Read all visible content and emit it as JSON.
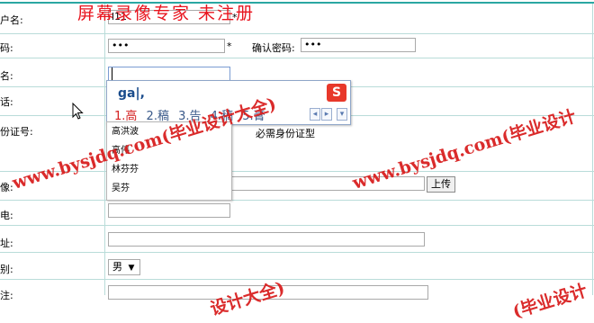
{
  "watermark": {
    "title": "屏幕录像专家 未注册",
    "site_a": "www.bysjdq.com(毕业设计大全)",
    "site_b": "www.bysjdq.com(毕业设计",
    "bottom_a": "设计大全)",
    "bottom_b": "(毕业设计"
  },
  "form": {
    "username": {
      "label": "户名:",
      "value": "l11",
      "star": "*"
    },
    "password": {
      "label": "码:",
      "value": "•••",
      "star": "*"
    },
    "confirm": {
      "label": "确认密码:",
      "value": "•••"
    },
    "name": {
      "label": "名:",
      "value": ""
    },
    "row4": {
      "label": "话:"
    },
    "idcard": {
      "label": "份证号:",
      "hint": "必需身份证型"
    },
    "photo": {
      "label": "像:",
      "upload_button": "上传"
    },
    "row8": {
      "label": "电:"
    },
    "row9": {
      "label": "址:"
    },
    "gender": {
      "label": "别:",
      "value": "男",
      "arrow": "▼"
    },
    "row11": {
      "label": "注:"
    }
  },
  "ime": {
    "composition": "ga|,",
    "candidates": [
      "1.高",
      "2.稿",
      "3.告",
      "4.稿",
      "5.膏"
    ],
    "logo": "S",
    "prev": "◂",
    "next": "▸",
    "menu": "▾"
  },
  "autocomplete": {
    "items": [
      "高洪波",
      "高伟",
      "林芬芬",
      "吴芬"
    ]
  }
}
